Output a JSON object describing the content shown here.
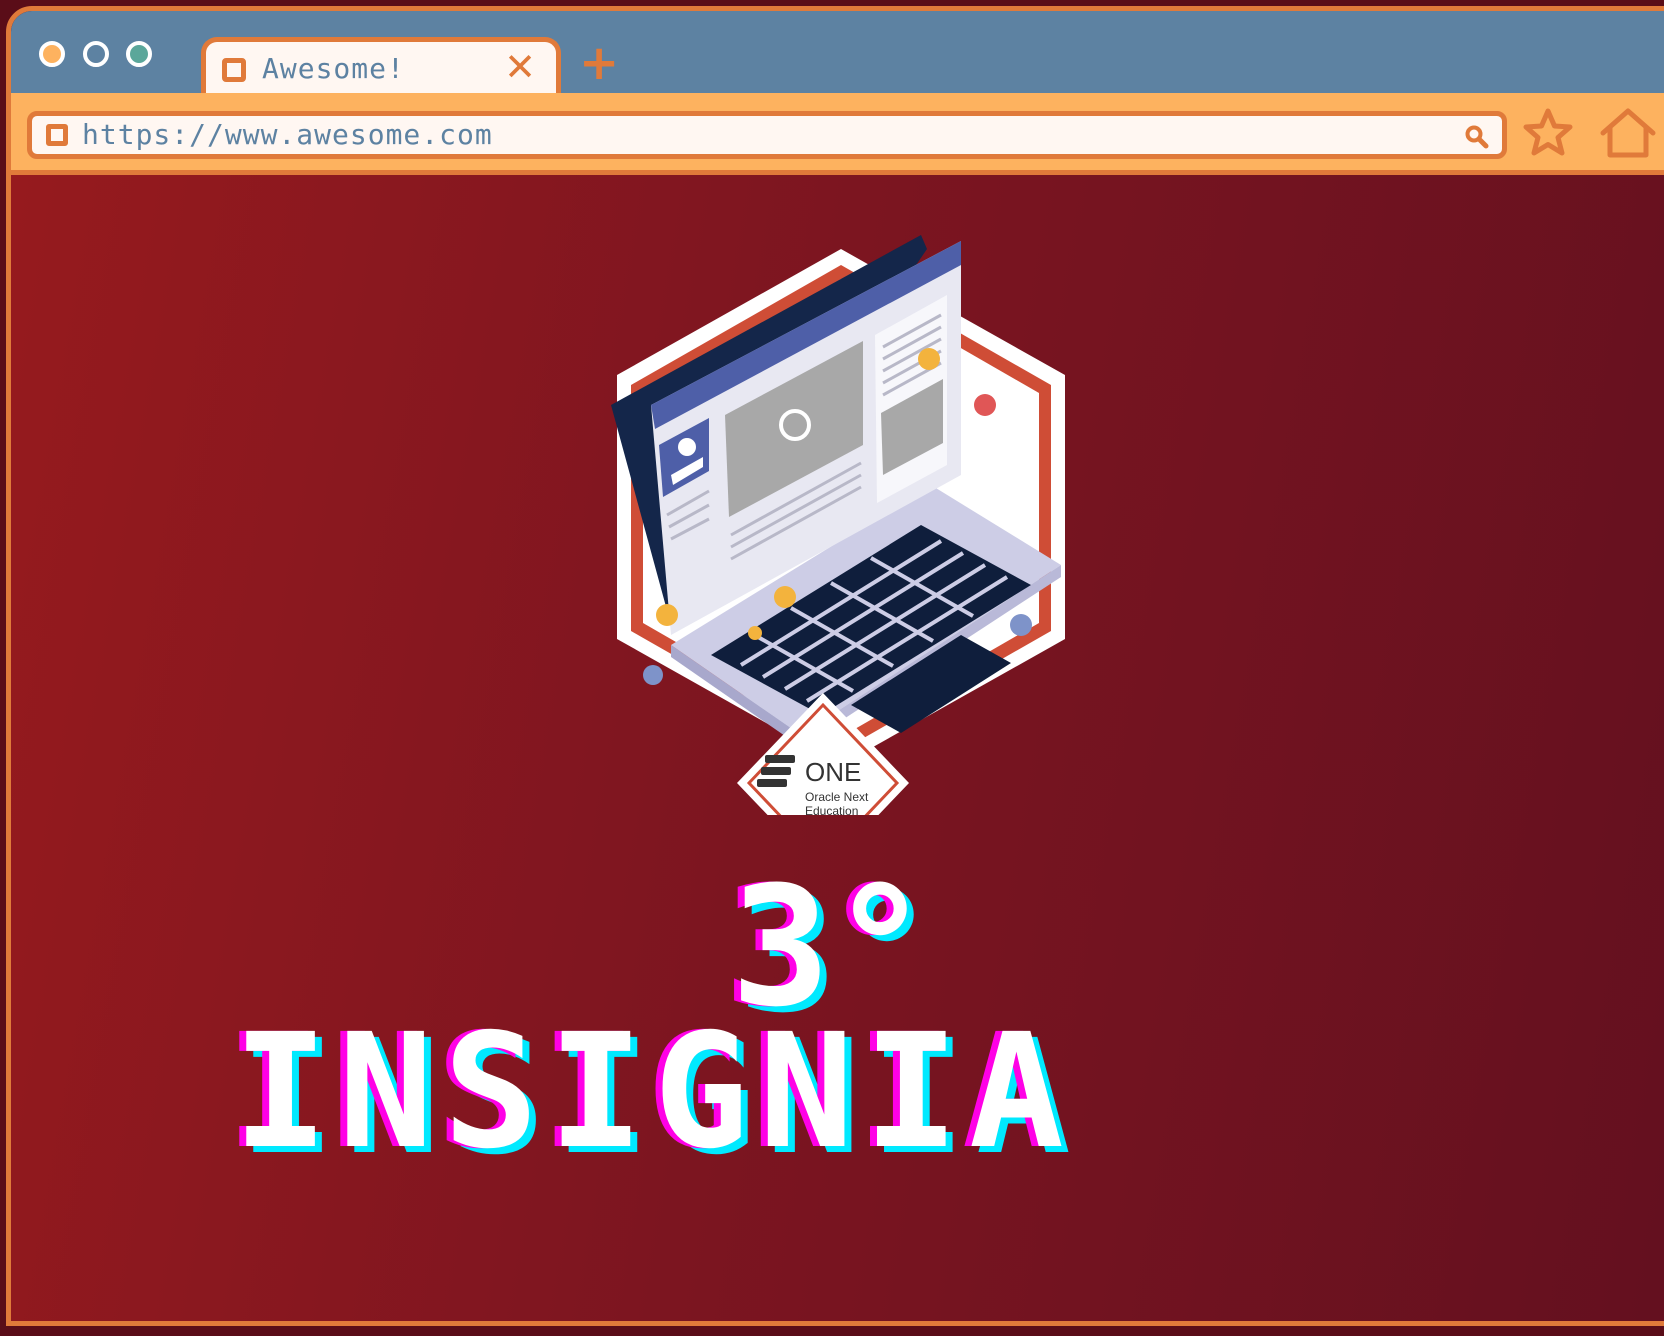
{
  "browser": {
    "tab_title": "Awesome!",
    "tab_close": "✕",
    "new_tab": "+",
    "url": "https://www.awesome.com"
  },
  "badge": {
    "brand": "ONE",
    "brand_line1": "Oracle Next",
    "brand_line2": "Education"
  },
  "headline": {
    "number": "3°",
    "word": "INSIGNIA"
  },
  "colors": {
    "frame": "#e07a3a",
    "titlebar": "#5d82a2",
    "toolbar": "#fdb25f",
    "background_start": "#961a1e",
    "background_end": "#63101f",
    "glitch_magenta": "#ff00e6",
    "glitch_cyan": "#00e9ff"
  }
}
